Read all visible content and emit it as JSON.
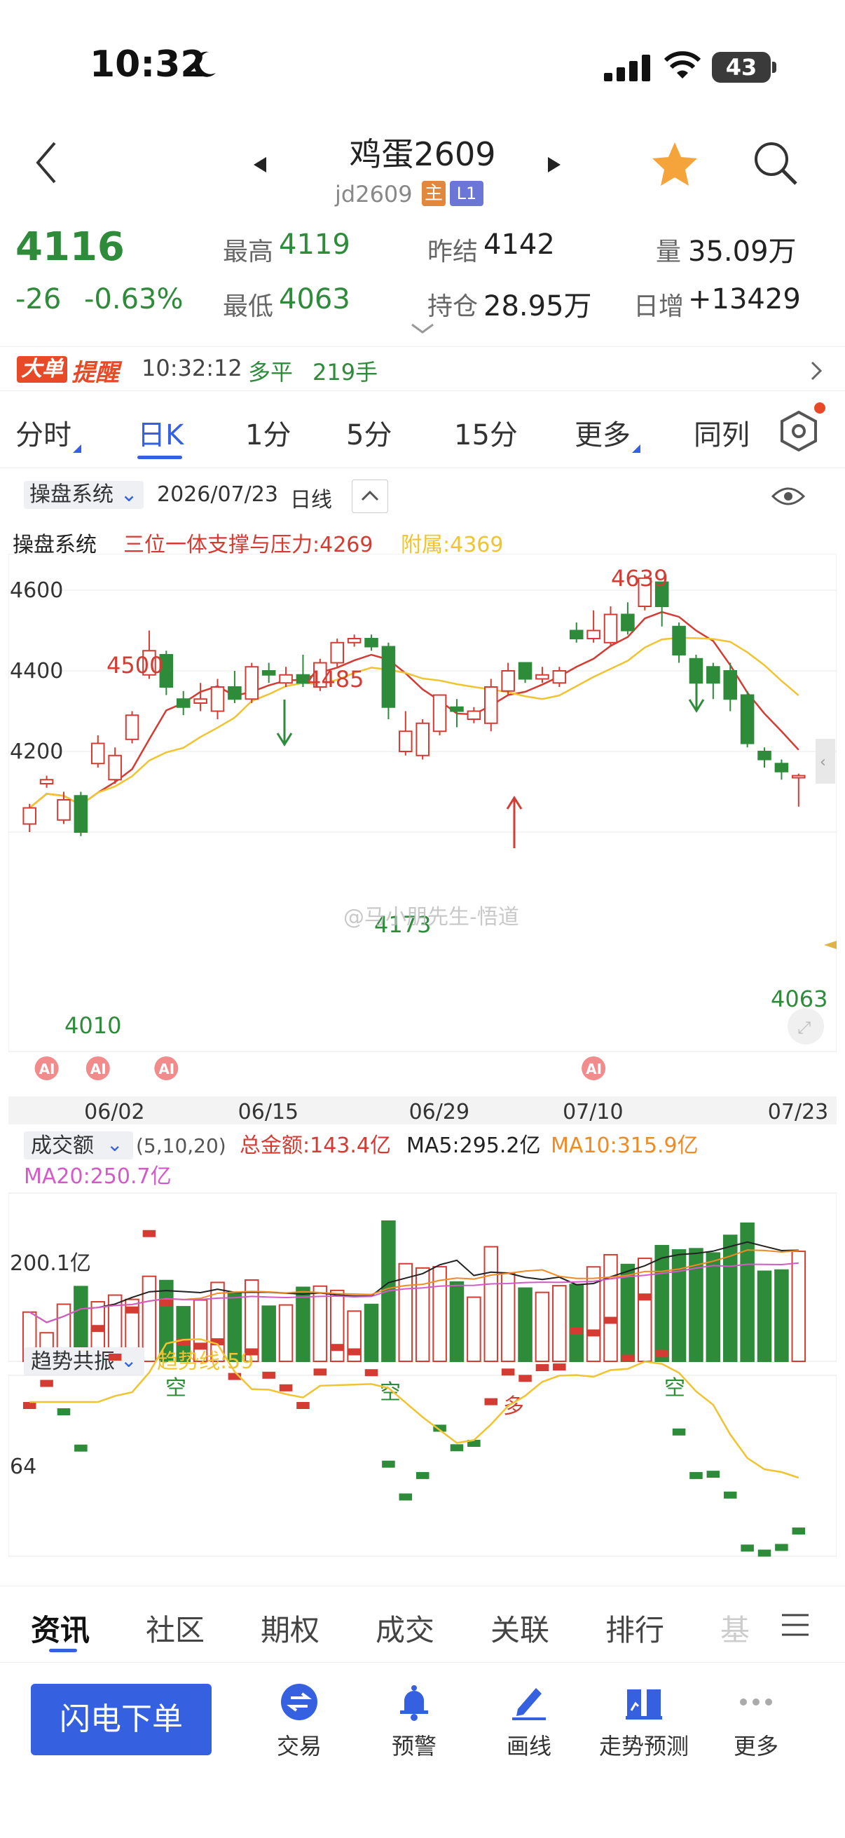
{
  "status": {
    "time": "10:32",
    "battery": "43"
  },
  "nav": {
    "title": "鸡蛋2609",
    "code": "jd2609",
    "tag_main": "主",
    "tag_level": "L1"
  },
  "quote": {
    "price": "4116",
    "change": "-26",
    "change_pct": "-0.63%",
    "high_label": "最高",
    "high": "4119",
    "low_label": "最低",
    "low": "4063",
    "prev_settle_label": "昨结",
    "prev_settle": "4142",
    "open_interest_label": "持仓",
    "open_interest": "28.95万",
    "volume_label": "量",
    "volume": "35.09万",
    "daily_inc_label": "日增",
    "daily_inc": "+13429"
  },
  "alert": {
    "badge1": "大单",
    "badge2": "提醒",
    "time": "10:32:12",
    "direction": "多平",
    "qty": "219手"
  },
  "tabs": [
    {
      "label": "分时"
    },
    {
      "label": "日K"
    },
    {
      "label": "1分"
    },
    {
      "label": "5分"
    },
    {
      "label": "15分"
    },
    {
      "label": "更多"
    },
    {
      "label": "同列"
    }
  ],
  "indicator_bar": {
    "system": "操盘系统",
    "date": "2026/07/23",
    "period": "日线"
  },
  "indicator_line": {
    "name": "操盘系统",
    "main": "三位一体支撑与压力:4269",
    "aux": "附属:4369"
  },
  "chart_data": {
    "type": "candlestick",
    "y_ticks": [
      "4600",
      "4400",
      "4200"
    ],
    "x_labels": [
      "06/02",
      "06/15",
      "06/29",
      "07/10",
      "07/23"
    ],
    "price_labels": {
      "h1": "4500",
      "h2": "4485",
      "h3": "4639",
      "l1": "4173",
      "last": "4063",
      "l0": "4010"
    },
    "watermark": "@马小朋先生-悟道",
    "ai_badges": [
      "AI",
      "AI",
      "AI",
      "AI"
    ],
    "candles": [
      [
        4020,
        4060,
        4000,
        4070
      ],
      [
        4120,
        4130,
        4110,
        4140
      ],
      [
        4030,
        4080,
        4020,
        4100
      ],
      [
        4090,
        4000,
        3990,
        4100
      ],
      [
        4170,
        4220,
        4160,
        4240
      ],
      [
        4130,
        4190,
        4120,
        4210
      ],
      [
        4230,
        4290,
        4220,
        4300
      ],
      [
        4390,
        4450,
        4380,
        4500
      ],
      [
        4440,
        4360,
        4340,
        4450
      ],
      [
        4330,
        4310,
        4290,
        4350
      ],
      [
        4320,
        4330,
        4300,
        4370
      ],
      [
        4300,
        4360,
        4280,
        4380
      ],
      [
        4360,
        4330,
        4320,
        4400
      ],
      [
        4330,
        4410,
        4320,
        4420
      ],
      [
        4400,
        4390,
        4370,
        4420
      ],
      [
        4370,
        4390,
        4360,
        4410
      ],
      [
        4390,
        4370,
        4360,
        4440
      ],
      [
        4360,
        4420,
        4350,
        4430
      ],
      [
        4420,
        4470,
        4410,
        4480
      ],
      [
        4470,
        4480,
        4460,
        4490
      ],
      [
        4480,
        4460,
        4450,
        4490
      ],
      [
        4460,
        4310,
        4280,
        4470
      ],
      [
        4200,
        4250,
        4190,
        4300
      ],
      [
        4190,
        4270,
        4180,
        4280
      ],
      [
        4250,
        4340,
        4240,
        4340
      ],
      [
        4310,
        4300,
        4260,
        4330
      ],
      [
        4280,
        4300,
        4270,
        4310
      ],
      [
        4270,
        4360,
        4250,
        4380
      ],
      [
        4350,
        4400,
        4340,
        4420
      ],
      [
        4420,
        4380,
        4370,
        4420
      ],
      [
        4380,
        4390,
        4370,
        4410
      ],
      [
        4370,
        4400,
        4360,
        4410
      ],
      [
        4500,
        4480,
        4470,
        4520
      ],
      [
        4480,
        4500,
        4470,
        4550
      ],
      [
        4470,
        4540,
        4460,
        4560
      ],
      [
        4540,
        4500,
        4490,
        4570
      ],
      [
        4560,
        4630,
        4550,
        4639
      ],
      [
        4620,
        4560,
        4510,
        4620
      ],
      [
        4510,
        4440,
        4420,
        4520
      ],
      [
        4430,
        4370,
        4340,
        4440
      ],
      [
        4410,
        4370,
        4330,
        4420
      ],
      [
        4400,
        4330,
        4300,
        4420
      ],
      [
        4340,
        4220,
        4210,
        4350
      ],
      [
        4200,
        4180,
        4160,
        4210
      ],
      [
        4170,
        4150,
        4130,
        4180
      ],
      [
        4140,
        4140,
        4063,
        4145
      ]
    ],
    "volume_axis": "200.1亿",
    "volume_legend": {
      "name": "成交额",
      "params": "(5,10,20)",
      "total": "总金额:143.4亿",
      "ma5": "MA5:295.2亿",
      "ma10": "MA10:315.9亿",
      "ma20": "MA20:250.7亿"
    },
    "trend_legend": {
      "name": "趋势共振",
      "line": "趋势线:59"
    },
    "trend_axis": "64",
    "trend_labels": [
      "空",
      "空",
      "多",
      "空"
    ]
  },
  "bottom_tabs": [
    "资讯",
    "社区",
    "期权",
    "成交",
    "关联",
    "排行",
    "基"
  ],
  "toolbar": {
    "order": "闪电下单",
    "items": [
      "交易",
      "预警",
      "画线",
      "走势预测",
      "更多"
    ]
  },
  "colors": {
    "up": "#d43c33",
    "down": "#2e8b3a",
    "accent": "#3561e0",
    "ma_yellow": "#f0c430",
    "ma_pink": "#d45ac8",
    "ma_orange": "#f08a24"
  }
}
